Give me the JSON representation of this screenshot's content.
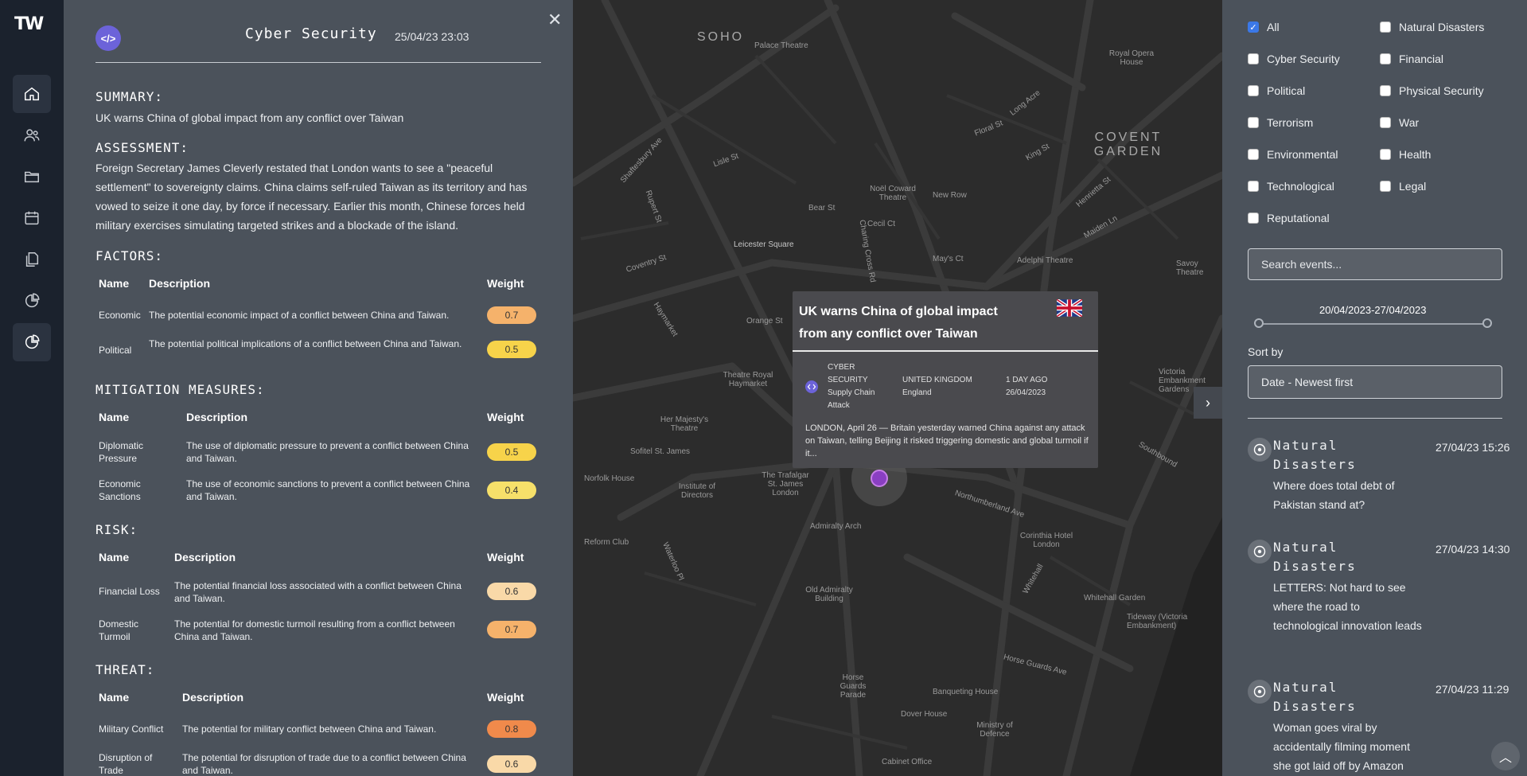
{
  "app": {
    "logo": "TW"
  },
  "nav": {
    "items": [
      "home-icon",
      "users-icon",
      "folder-icon",
      "calendar-icon",
      "documents-icon",
      "pie-chart-icon",
      "analytics-icon"
    ]
  },
  "detail": {
    "badge": "</>",
    "title": "Cyber Security",
    "date": "25/04/23 23:03",
    "close": "✕",
    "summary_heading": "SUMMARY:",
    "summary": "UK warns China of global impact from any conflict over Taiwan",
    "assessment_heading": "ASSESSMENT:",
    "assessment": "Foreign Secretary James Cleverly restated that London wants to see a \"peaceful settlement\" to sovereignty claims. China claims self-ruled Taiwan as its territory and has vowed to seize it one day, by force if necessary. Earlier this month, Chinese forces held military exercises simulating targeted strikes and a blockade of the island.",
    "col_name": "Name",
    "col_description": "Description",
    "col_weight": "Weight",
    "factors": {
      "heading": "FACTORS:",
      "rows": [
        {
          "name": "Economic",
          "description": "The potential economic impact of a conflict between China and Taiwan.",
          "weight": "0.7",
          "color": "#f5b26b"
        },
        {
          "name": "Political",
          "description": "The potential political implications of a conflict between China and Taiwan.",
          "weight": "0.5",
          "color": "#f7d34a"
        }
      ]
    },
    "mitigation": {
      "heading": "MITIGATION MEASURES:",
      "rows": [
        {
          "name": "Diplomatic Pressure",
          "description": "The use of diplomatic pressure to prevent a conflict between China and Taiwan.",
          "weight": "0.5",
          "color": "#f7d34a"
        },
        {
          "name": "Economic Sanctions",
          "description": "The use of economic sanctions to prevent a conflict between China and Taiwan.",
          "weight": "0.4",
          "color": "#f6e06a"
        }
      ]
    },
    "risk": {
      "heading": "RISK:",
      "rows": [
        {
          "name": "Financial Loss",
          "description": "The potential financial loss associated with a conflict between China and Taiwan.",
          "weight": "0.6",
          "color": "#f9d9a8"
        },
        {
          "name": "Domestic Turmoil",
          "description": "The potential for domestic turmoil resulting from a conflict between China and Taiwan.",
          "weight": "0.7",
          "color": "#f5b26b"
        }
      ]
    },
    "threat": {
      "heading": "THREAT:",
      "rows": [
        {
          "name": "Military Conflict",
          "description": "The potential for military conflict between China and Taiwan.",
          "weight": "0.8",
          "color": "#f08a4b"
        },
        {
          "name": "Disruption of Trade",
          "description": "The potential for disruption of trade due to a conflict between China and Taiwan.",
          "weight": "0.6",
          "color": "#f9d9a8"
        }
      ]
    }
  },
  "map": {
    "labels": [
      "SOHO",
      "COVENT GARDEN",
      "Palace Theatre",
      "Royal Opera House",
      "Leicester Square",
      "Noël Coward Theatre",
      "Bear St",
      "Cecil Ct",
      "New Row",
      "May's Ct",
      "Adelphi Theatre",
      "Savoy Theatre",
      "Orange St",
      "Theatre Royal Haymarket",
      "Her Majesty's Theatre",
      "Sofitel St. James",
      "Norfolk House",
      "Institute of Directors",
      "The Trafalgar St. James London",
      "Admiralty Arch",
      "Northumberland Ave",
      "Corinthia Hotel London",
      "Old Admiralty Building",
      "Whitehall Garden",
      "Horse Guards Parade",
      "Banqueting House",
      "Horse Guards Ave",
      "Dover House",
      "Ministry of Defence",
      "Cabinet Office",
      "Reform Club",
      "Victoria Embankment Gardens",
      "Tideway (Victoria Embankment)",
      "Southbound",
      "Coventry St",
      "Haymarket",
      "Charing Cross Rd",
      "Long Acre",
      "Floral St",
      "King St",
      "Henrietta St",
      "Maiden Ln",
      "Shaftesbury Ave",
      "Lisle St",
      "Rupert St",
      "Waterloo Pl",
      "Whitehall"
    ],
    "popup": {
      "title": "UK warns China of global impact from any conflict over Taiwan",
      "category": "CYBER SECURITY",
      "subcategory": "Supply Chain Attack",
      "country": "UNITED KINGDOM",
      "region": "England",
      "ago": "1 DAY AGO",
      "date": "26/04/2023",
      "body": "LONDON, April 26 — Britain yesterday warned China against any attack on Taiwan, telling Beijing it risked triggering domestic and global turmoil if it..."
    },
    "expander": "›"
  },
  "panel": {
    "filters": [
      {
        "label": "All",
        "checked": true
      },
      {
        "label": "Natural Disasters",
        "checked": false
      },
      {
        "label": "Cyber Security",
        "checked": false
      },
      {
        "label": "Financial",
        "checked": false
      },
      {
        "label": "Political",
        "checked": false
      },
      {
        "label": "Physical Security",
        "checked": false
      },
      {
        "label": "Terrorism",
        "checked": false
      },
      {
        "label": "War",
        "checked": false
      },
      {
        "label": "Environmental",
        "checked": false
      },
      {
        "label": "Health",
        "checked": false
      },
      {
        "label": "Technological",
        "checked": false
      },
      {
        "label": "Legal",
        "checked": false
      },
      {
        "label": "Reputational",
        "checked": false
      }
    ],
    "search_placeholder": "Search events...",
    "date_range": "20/04/2023-27/04/2023",
    "sort_label": "Sort by",
    "sort_value": "Date - Newest first",
    "events": [
      {
        "category": "Natural Disasters",
        "date": "27/04/23 15:26",
        "title": "Where does total debt of Pakistan stand at?"
      },
      {
        "category": "Natural Disasters",
        "date": "27/04/23 14:30",
        "title": "LETTERS: Not hard to see where the road to technological innovation leads"
      },
      {
        "category": "Natural Disasters",
        "date": "27/04/23 11:29",
        "title": "Woman goes viral by accidentally filming moment she got laid off by Amazon"
      }
    ]
  }
}
